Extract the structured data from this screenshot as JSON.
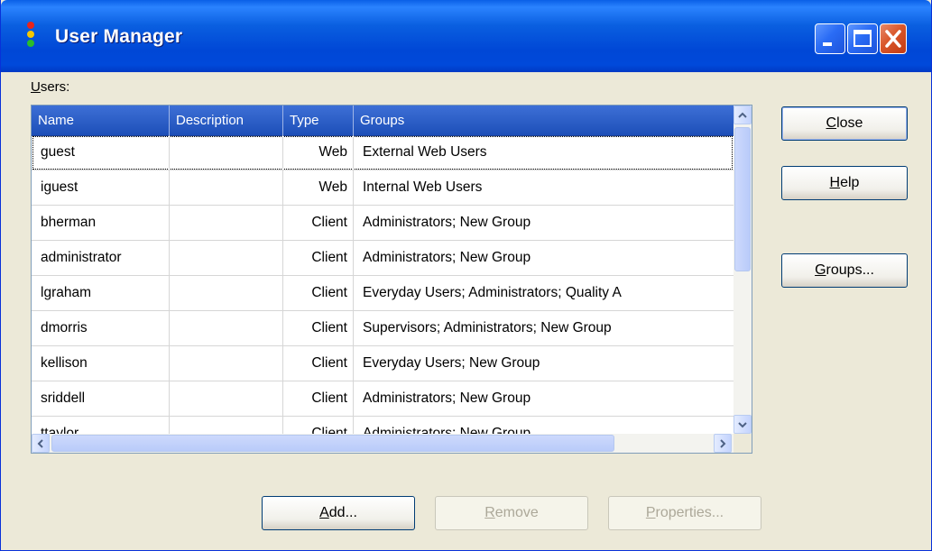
{
  "window": {
    "title": "User Manager",
    "accent_color": "#0054e3",
    "icon": "traffic-light-icon",
    "caption_buttons": {
      "minimize": "minimize-icon",
      "maximize": "maximize-icon",
      "close": "close-icon"
    }
  },
  "users_label": {
    "mnemonic": "U",
    "rest": "sers:"
  },
  "table": {
    "columns": [
      "Name",
      "Description",
      "Type",
      "Groups"
    ],
    "rows": [
      {
        "name": "guest",
        "description": "",
        "type": "Web",
        "groups": "External Web Users"
      },
      {
        "name": "iguest",
        "description": "",
        "type": "Web",
        "groups": "Internal Web Users"
      },
      {
        "name": "bherman",
        "description": "",
        "type": "Client",
        "groups": "Administrators; New Group"
      },
      {
        "name": "administrator",
        "description": "",
        "type": "Client",
        "groups": "Administrators; New Group"
      },
      {
        "name": "lgraham",
        "description": "",
        "type": "Client",
        "groups": "Everyday Users; Administrators; Quality A"
      },
      {
        "name": "dmorris",
        "description": "",
        "type": "Client",
        "groups": "Supervisors; Administrators; New Group"
      },
      {
        "name": "kellison",
        "description": "",
        "type": "Client",
        "groups": "Everyday Users; New Group"
      },
      {
        "name": "sriddell",
        "description": "",
        "type": "Client",
        "groups": "Administrators; New Group"
      },
      {
        "name": "ttaylor",
        "description": "",
        "type": "Client",
        "groups": "Administrators; New Group"
      }
    ],
    "focused_row": 0
  },
  "buttons": {
    "close": {
      "mnemonic": "C",
      "rest": "lose"
    },
    "help": {
      "mnemonic": "H",
      "rest": "elp"
    },
    "groups": {
      "mnemonic": "G",
      "rest": "roups..."
    },
    "add": {
      "mnemonic": "A",
      "rest": "dd..."
    },
    "remove": {
      "mnemonic": "R",
      "rest": "emove",
      "enabled": false
    },
    "properties": {
      "mnemonic": "P",
      "rest": "roperties...",
      "enabled": false
    }
  }
}
